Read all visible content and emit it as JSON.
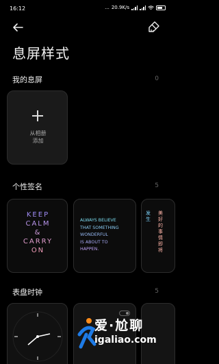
{
  "status_bar": {
    "time": "16:12",
    "dots": "...",
    "network_speed": "20.9K/s",
    "battery": ""
  },
  "header": {
    "title": "息屏样式"
  },
  "sections": {
    "my_screens": {
      "title": "我的息屏",
      "count": "0",
      "add_label": "从相册\n添加"
    },
    "signatures": {
      "title": "个性签名",
      "count": "5",
      "cards": [
        {
          "text": "KEEP\nCALM\n&\nCARRY\nON"
        },
        {
          "text": "ALWAYS BELIEVE\nTHAT SOMETHING\nWONDERFUL\nIS ABOUT TO\nHAPPEN."
        },
        {
          "col1": "发生",
          "col2": "美好的事情即将"
        }
      ]
    },
    "clocks": {
      "title": "表盘时钟",
      "count": "5"
    }
  },
  "watermark": {
    "name": "爱·尬聊",
    "url": "igaliao.com"
  },
  "colors": {
    "background": "#000000",
    "card": "#1a1a1a",
    "card_border": "#2d2d2d",
    "muted": "#666666",
    "gradient_warm": "#ff9fb4",
    "gradient_cool": "#7ef0ff"
  },
  "icons": [
    "back-arrow-icon",
    "brush-icon",
    "plus-icon",
    "toggle-icon",
    "signal-icon",
    "wifi-icon",
    "battery-icon"
  ]
}
